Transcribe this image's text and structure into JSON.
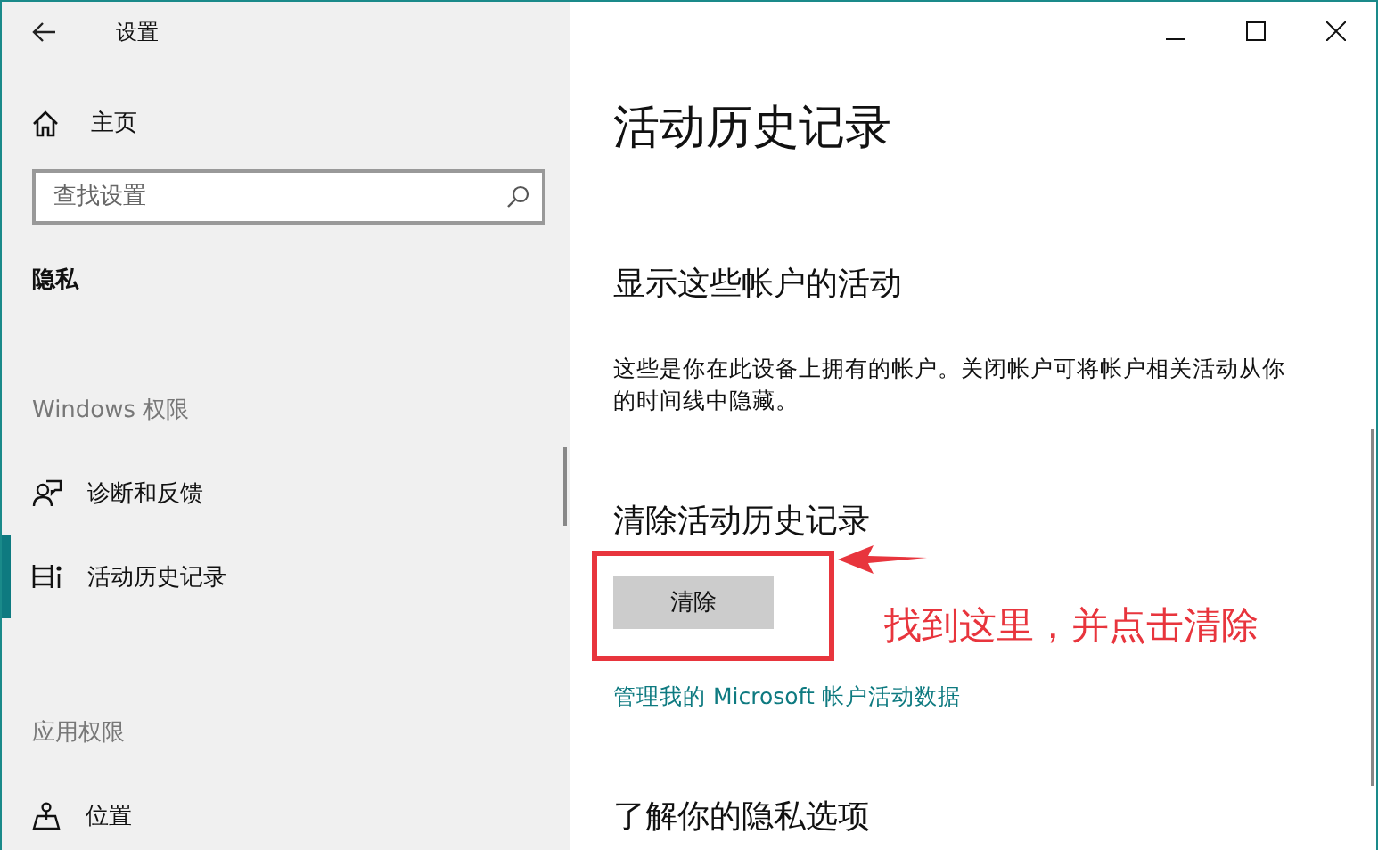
{
  "window": {
    "title": "设置"
  },
  "sidebar": {
    "home": "主页",
    "search": {
      "placeholder": "查找设置"
    },
    "section_title": "隐私",
    "groups": [
      {
        "heading": "Windows 权限",
        "items": [
          {
            "label": "诊断和反馈",
            "kind": "feedback",
            "selected": false
          },
          {
            "label": "活动历史记录",
            "kind": "timeline",
            "selected": true
          }
        ]
      },
      {
        "heading": "应用权限",
        "items": [
          {
            "label": "位置",
            "kind": "location",
            "selected": false
          }
        ]
      }
    ]
  },
  "content": {
    "title": "活动历史记录",
    "sections": [
      {
        "heading": "显示这些帐户的活动",
        "text": "这些是你在此设备上拥有的帐户。关闭帐户可将帐户相关活动从你的时间线中隐藏。"
      },
      {
        "heading": "清除活动历史记录",
        "button": "清除",
        "link": "管理我的 Microsoft 帐户活动数据"
      },
      {
        "heading": "了解你的隐私选项"
      }
    ]
  },
  "annotation": {
    "text": "找到这里，并点击清除"
  }
}
